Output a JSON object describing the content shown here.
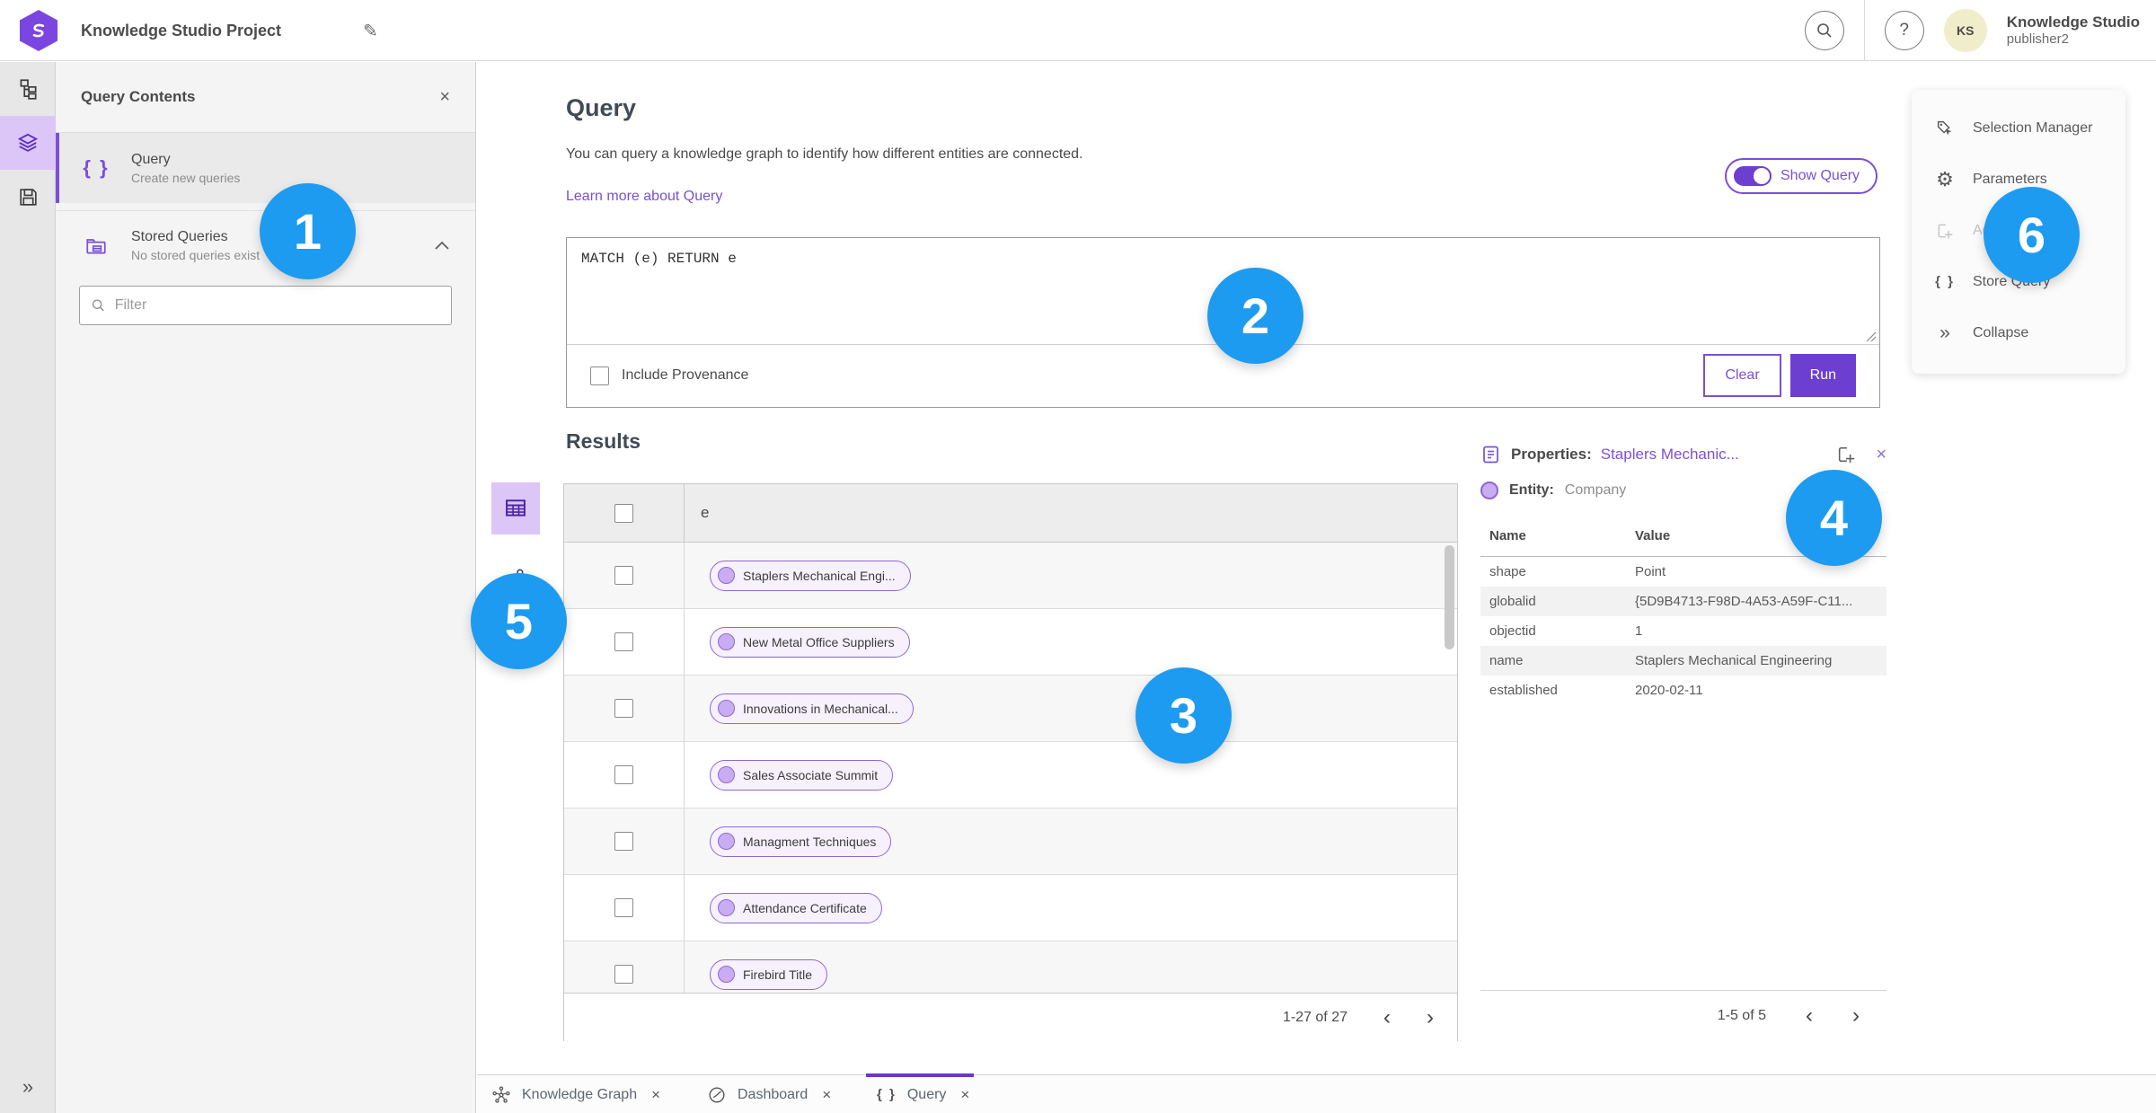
{
  "header": {
    "app_title": "Knowledge Studio Project",
    "avatar_initials": "KS",
    "user_name": "Knowledge Studio",
    "user_sub": "publisher2"
  },
  "left_panel": {
    "title": "Query Contents",
    "query_item": {
      "label": "Query",
      "sub": "Create new queries"
    },
    "stored_item": {
      "label": "Stored Queries",
      "sub": "No stored queries exist"
    },
    "filter_placeholder": "Filter"
  },
  "query_section": {
    "title": "Query",
    "description": "You can query a knowledge graph to identify how different entities are connected.",
    "learn_more": "Learn more about Query",
    "show_query_label": "Show Query",
    "query_text": "MATCH (e) RETURN e",
    "include_provenance_label": "Include Provenance",
    "clear_label": "Clear",
    "run_label": "Run"
  },
  "results": {
    "title": "Results",
    "column_header": "e",
    "rows": [
      "Staplers Mechanical Engi...",
      "New Metal Office Suppliers",
      "Innovations in Mechanical...",
      "Sales Associate Summit",
      "Managment Techniques",
      "Attendance Certificate",
      "Firebird Title"
    ],
    "pagination": "1-27 of 27"
  },
  "properties": {
    "title_label": "Properties:",
    "title_link": "Staplers Mechanic...",
    "entity_label": "Entity:",
    "entity_value": "Company",
    "col_name": "Name",
    "col_value": "Value",
    "rows": [
      {
        "name": "shape",
        "value": "Point"
      },
      {
        "name": "globalid",
        "value": "{5D9B4713-F98D-4A53-A59F-C11..."
      },
      {
        "name": "objectid",
        "value": "1"
      },
      {
        "name": "name",
        "value": "Staplers Mechanical Engineering"
      },
      {
        "name": "established",
        "value": "2020-02-11"
      }
    ],
    "pagination": "1-5 of 5"
  },
  "actions_panel": {
    "items": [
      {
        "label": "Selection Manager"
      },
      {
        "label": "Parameters"
      },
      {
        "label": "Add"
      },
      {
        "label": "Store Query"
      },
      {
        "label": "Collapse"
      }
    ]
  },
  "bottom_tabs": [
    {
      "label": "Knowledge Graph"
    },
    {
      "label": "Dashboard"
    },
    {
      "label": "Query"
    }
  ],
  "annotations": [
    "1",
    "2",
    "3",
    "4",
    "5",
    "6"
  ],
  "icons": {
    "braces": "{ }",
    "collapse": "»",
    "pencil": "✎",
    "help": "?",
    "close": "×",
    "chevron_left": "‹",
    "chevron_right": "›",
    "gear": "⚙"
  },
  "colors": {
    "accent_purple": "#6c3fd1",
    "link_purple": "#7a4fd8",
    "annotation_blue": "#1d9bf0",
    "pill_fill": "#f6f1fc",
    "pill_border": "#9066d6",
    "rail_active": "#dcc6f7"
  }
}
